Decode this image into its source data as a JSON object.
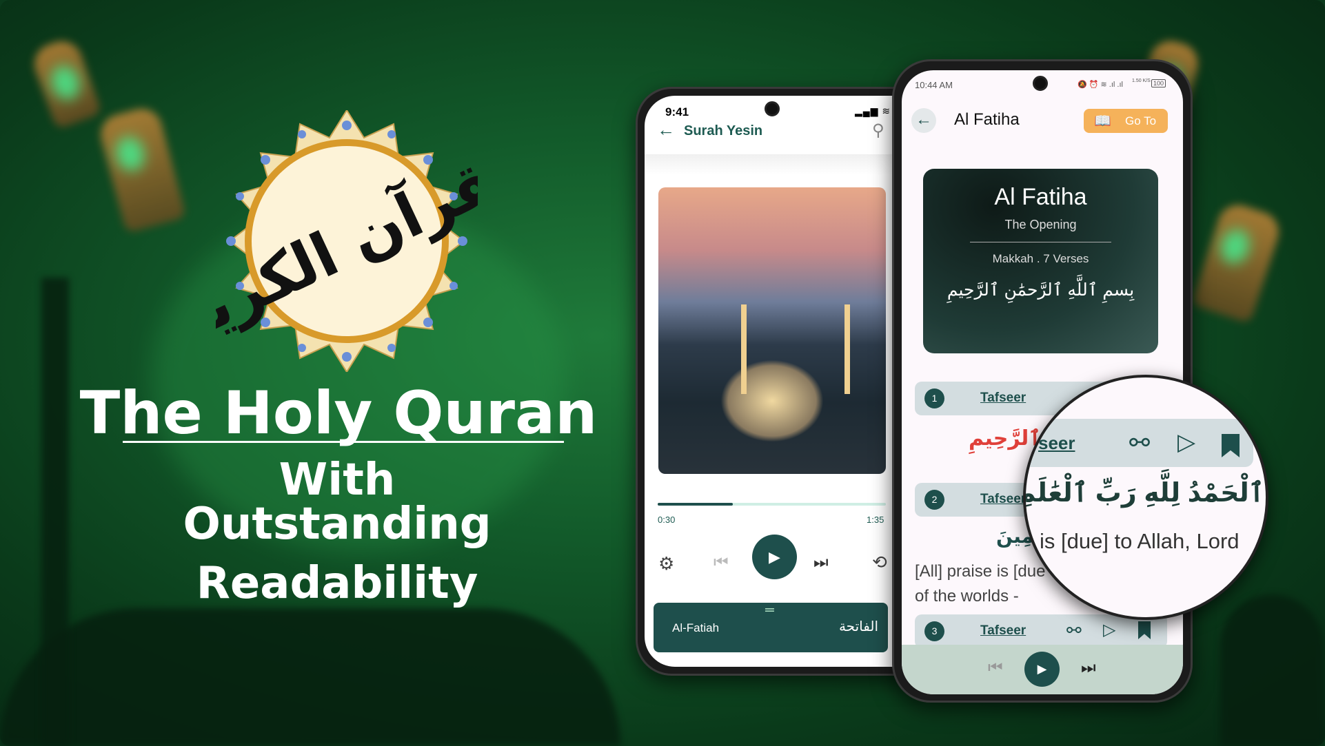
{
  "logo": {
    "calligraphy": "القرآن الكريم"
  },
  "headline": {
    "title": "The Holy Quran",
    "line1": "With",
    "line2": "Outstanding",
    "line3": "Readability"
  },
  "player_screen": {
    "status_time": "9:41",
    "title": "Surah Yesin",
    "elapsed": "0:30",
    "duration": "1:35",
    "progress_percent": 33,
    "now_playing_en": "Al-Fatiah",
    "now_playing_ar": "الفاتحة",
    "icons": [
      "back-arrow-icon",
      "search-icon",
      "settings-icon",
      "previous-icon",
      "play-icon",
      "next-icon",
      "repeat-icon",
      "drag-handle-icon"
    ]
  },
  "reader_screen": {
    "status_time": "10:44 AM",
    "battery": "100",
    "net_speed": "1.50 K/S",
    "title": "Al Fatiha",
    "goto_label": "Go To",
    "card": {
      "title": "Al Fatiha",
      "subtitle": "The Opening",
      "meta": "Makkah .  7 Verses",
      "bismillah": "بِسمِ ٱللَّهِ ٱلرَّحمَٰنِ ٱلرَّحِيمِ"
    },
    "tafseer_label": "Tafseer",
    "verses": [
      {
        "number": "1",
        "arabic_tail": "ٱلرَّحِيمِ"
      },
      {
        "number": "2",
        "arabic_tail": "لَمِينَ",
        "translation_line1": "[All] praise is [due -",
        "translation_line2": "of the worlds -"
      },
      {
        "number": "3"
      }
    ],
    "accent": "#1e4f4c",
    "goto_color": "#f5b25a",
    "red_text": "#e0403a"
  },
  "magnifier": {
    "tafseer_partial": "seer",
    "arabic": "ٱلْحَمْدُ لِلَّهِ رَبِّ ٱلْعَٰلَمِينَ",
    "translation": "is [due] to Allah, Lord"
  }
}
